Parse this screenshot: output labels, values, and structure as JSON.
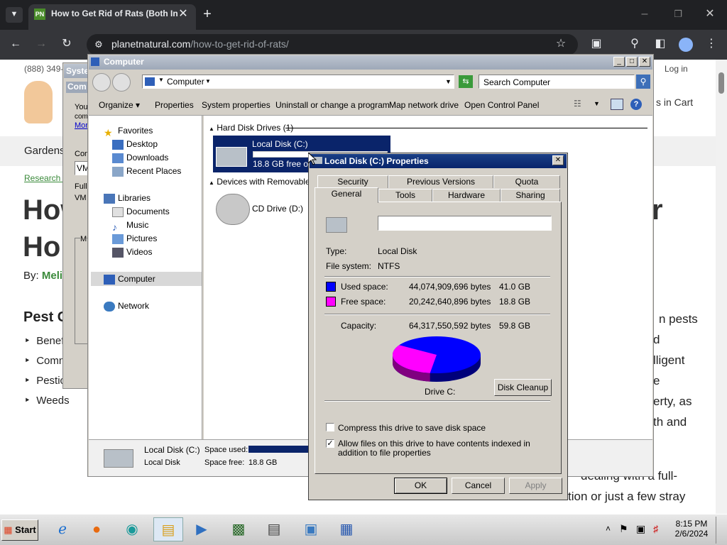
{
  "browser": {
    "tab_title": "How to Get Rid of Rats (Both In",
    "favicon_text": "PN",
    "url_host": "planetnatural.com",
    "url_path": "/how-to-get-rid-of-rats/"
  },
  "webpage": {
    "phone": "(888) 349-",
    "login": "Log in",
    "cart": "s in Cart",
    "nav": "Gardens",
    "breadcrumb": "Research C",
    "title_line1": "How",
    "title_line2": "Hon",
    "title_right": "r",
    "byline": "By:",
    "author": "Meli",
    "section": "Pest C",
    "list": [
      "Benefi",
      "Comm",
      "Pestici",
      "Weeds"
    ],
    "right_text": [
      "n pests",
      "d",
      "lligent",
      "e",
      "erty, as",
      "th and"
    ],
    "bottom_text": [
      "dealing with a full-",
      "tion or just a few stray"
    ]
  },
  "system_window": {
    "title": "Syste",
    "com": "Com",
    "you": "You",
    "com2": "com",
    "more": "Mor",
    "com3": "Com",
    "vm": "VM",
    "full": "Full",
    "vm2": "VM",
    "m": "M"
  },
  "explorer": {
    "title": "Computer",
    "address": "Computer",
    "search_placeholder": "Search Computer",
    "toolbar": [
      "Organize",
      "Properties",
      "System properties",
      "Uninstall or change a program",
      "Map network drive",
      "Open Control Panel"
    ],
    "nav": {
      "favorites": "Favorites",
      "fav_items": [
        "Desktop",
        "Downloads",
        "Recent Places"
      ],
      "libraries": "Libraries",
      "lib_items": [
        "Documents",
        "Music",
        "Pictures",
        "Videos"
      ],
      "computer": "Computer",
      "network": "Network"
    },
    "groups": {
      "hdd": "Hard Disk Drives (1)",
      "removable": "Devices with Removable Sto"
    },
    "drive_c": {
      "name": "Local Disk (C:)",
      "free": "18.8 GB free of",
      "used_fraction": 0.69
    },
    "drive_d": {
      "name": "CD Drive (D:)"
    },
    "details": {
      "name": "Local Disk (C:)",
      "type": "Local Disk",
      "space_used_label": "Space used:",
      "space_free_label": "Space free:",
      "space_free": "18.8 GB"
    }
  },
  "dialog": {
    "title": "Local Disk (C:) Properties",
    "tabs_row1": [
      "Security",
      "Previous Versions",
      "Quota"
    ],
    "tabs_row2": [
      "General",
      "Tools",
      "Hardware",
      "Sharing"
    ],
    "label_value": "",
    "type_label": "Type:",
    "type_value": "Local Disk",
    "fs_label": "File system:",
    "fs_value": "NTFS",
    "used_label": "Used space:",
    "used_bytes": "44,074,909,696 bytes",
    "used_gb": "41.0 GB",
    "free_label": "Free space:",
    "free_bytes": "20,242,640,896 bytes",
    "free_gb": "18.8 GB",
    "capacity_label": "Capacity:",
    "capacity_bytes": "64,317,550,592 bytes",
    "capacity_gb": "59.8 GB",
    "drive_label": "Drive C:",
    "disk_cleanup": "Disk Cleanup",
    "compress_label": "Compress this drive to save disk space",
    "index_label": "Allow files on this drive to have contents indexed in addition to file properties",
    "ok": "OK",
    "cancel": "Cancel",
    "apply": "Apply",
    "colors": {
      "used": "#0000ff",
      "free": "#ff00ff"
    }
  },
  "taskbar": {
    "start": "Start",
    "time": "8:15 PM",
    "date": "2/6/2024"
  }
}
